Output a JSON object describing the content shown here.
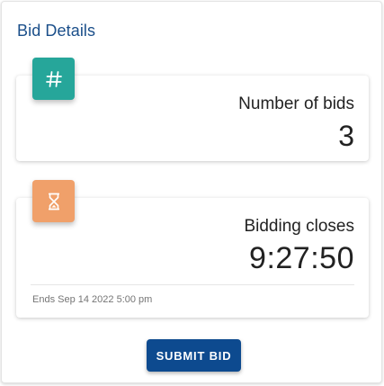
{
  "panel": {
    "title": "Bid Details"
  },
  "bids_card": {
    "icon": "hash-icon",
    "icon_color": "#26a69a",
    "label": "Number of bids",
    "value": "3"
  },
  "closing_card": {
    "icon": "hourglass-icon",
    "icon_color": "#f0a06a",
    "label": "Bidding closes",
    "value": "9:27:50",
    "footer": "Ends Sep 14 2022 5:00 pm"
  },
  "actions": {
    "submit_label": "SUBMIT BID",
    "submit_color": "#0d4a8f"
  }
}
